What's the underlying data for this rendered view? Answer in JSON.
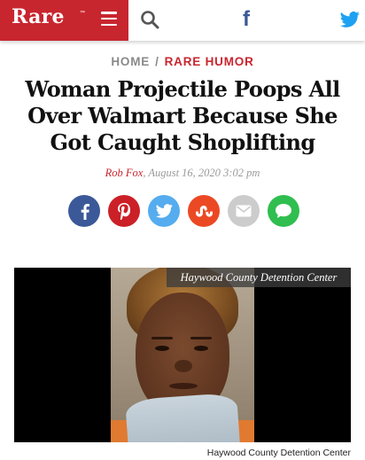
{
  "header": {
    "logo_text": "Rare",
    "logo_tm": "™",
    "brand_color": "#c8262f",
    "menu_icon": "hamburger-menu-icon",
    "search_icon": "search-icon",
    "facebook_label": "f",
    "facebook_color": "#3b5998",
    "twitter_icon": "twitter-bird-icon",
    "twitter_color": "#1da1f2"
  },
  "breadcrumb": {
    "home": "HOME",
    "separator": "/",
    "category": "RARE HUMOR"
  },
  "article": {
    "headline": "Woman Projectile Poops All Over Walmart Because She Got Caught Shoplifting",
    "author": "Rob Fox",
    "date": ", August 16, 2020 3:02 pm"
  },
  "share": [
    {
      "network": "facebook",
      "icon": "facebook-icon",
      "color": "#3b5998"
    },
    {
      "network": "pinterest",
      "icon": "pinterest-icon",
      "color": "#cb2027"
    },
    {
      "network": "twitter",
      "icon": "twitter-icon",
      "color": "#55acee"
    },
    {
      "network": "stumbleupon",
      "icon": "stumbleupon-icon",
      "color": "#eb4924"
    },
    {
      "network": "email",
      "icon": "email-icon",
      "color": "#cccccc"
    },
    {
      "network": "sms",
      "icon": "chat-bubble-icon",
      "color": "#2fbe4f"
    }
  ],
  "image": {
    "overlay_caption": "Haywood County Detention Center",
    "credit": "Haywood County Detention Center"
  }
}
